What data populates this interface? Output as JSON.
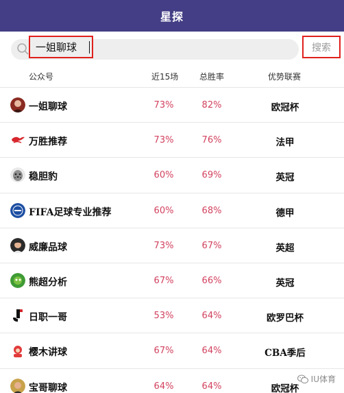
{
  "header": {
    "title": "星探"
  },
  "search": {
    "value": "一姐聊球",
    "button_label": "搜索"
  },
  "columns": {
    "name": "公众号",
    "recent": "近15场",
    "rate": "总胜率",
    "league": "优势联赛"
  },
  "rows": [
    {
      "name": "一姐聊球",
      "recent": "73%",
      "rate": "82%",
      "league": "欧冠杯",
      "icon": "portrait-avatar"
    },
    {
      "name": "万胜推荐",
      "recent": "73%",
      "rate": "76%",
      "league": "法甲",
      "icon": "winged-logo-avatar"
    },
    {
      "name": "稳胆豹",
      "recent": "60%",
      "rate": "69%",
      "league": "英冠",
      "icon": "leopard-avatar"
    },
    {
      "name": "FIFA足球专业推荐",
      "recent": "60%",
      "rate": "68%",
      "league": "德甲",
      "icon": "fifa-logo-avatar"
    },
    {
      "name": "威廉品球",
      "recent": "73%",
      "rate": "67%",
      "league": "英超",
      "icon": "portrait-avatar"
    },
    {
      "name": "熊超分析",
      "recent": "67%",
      "rate": "66%",
      "league": "英冠",
      "icon": "green-ball-avatar"
    },
    {
      "name": "日职一哥",
      "recent": "53%",
      "rate": "64%",
      "league": "欧罗巴杯",
      "icon": "j-league-logo-avatar"
    },
    {
      "name": "樱木讲球",
      "recent": "67%",
      "rate": "64%",
      "league": "CBA季后",
      "icon": "red-character-avatar"
    },
    {
      "name": "宝哥聊球",
      "recent": "64%",
      "rate": "64%",
      "league": "欧冠杯",
      "icon": "portrait-avatar"
    }
  ],
  "watermark": {
    "text": "IU体育",
    "icon": "wechat-icon"
  },
  "colors": {
    "header_bg": "#433e85",
    "percent": "#d2415e",
    "highlight_border": "#e0201c"
  }
}
